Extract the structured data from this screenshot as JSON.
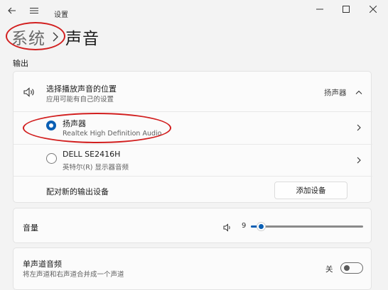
{
  "window": {
    "title": "设置",
    "controls": [
      "minimize-icon",
      "maximize-icon",
      "close-icon"
    ]
  },
  "breadcrumb": {
    "parent": "系统",
    "current": "声音"
  },
  "output": {
    "section_label": "输出",
    "choose_device": {
      "title": "选择播放声音的位置",
      "subtitle": "应用可能有自己的设置",
      "selected_value": "扬声器"
    },
    "devices": [
      {
        "name": "扬声器",
        "description": "Realtek High Definition Audio",
        "selected": true
      },
      {
        "name": "DELL SE2416H",
        "description": "英特尔(R) 显示器音频",
        "selected": false
      }
    ],
    "pair_new": {
      "label": "配对新的输出设备",
      "button": "添加设备"
    }
  },
  "volume": {
    "label": "音量",
    "value": "9",
    "level_percent": 9
  },
  "mono_audio": {
    "title": "单声道音频",
    "subtitle": "将左声道和右声道合并成一个声道",
    "state_label": "关",
    "enabled": false
  },
  "colors": {
    "accent": "#0a5fb4",
    "annotation_red": "#d21f1f"
  }
}
